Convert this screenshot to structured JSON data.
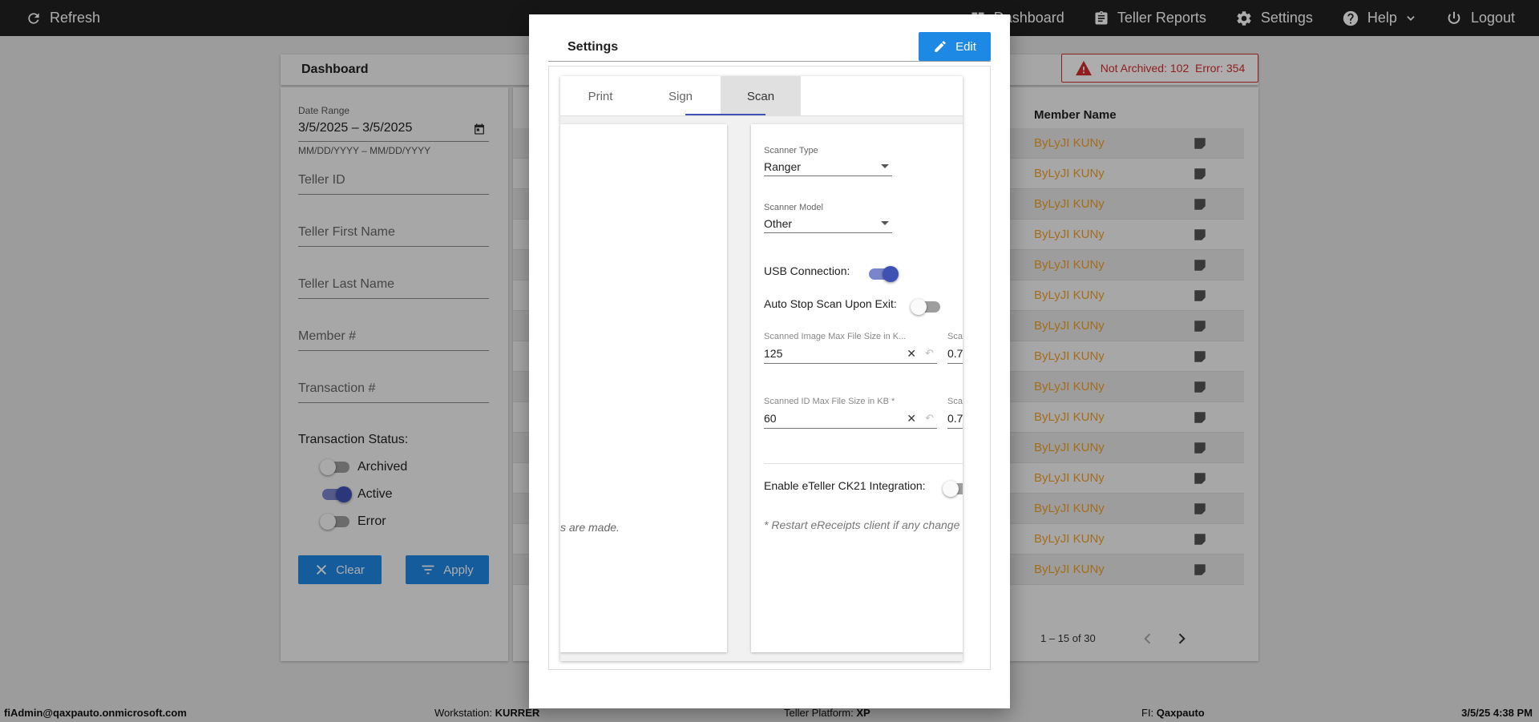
{
  "topbar": {
    "refresh_label": "Refresh",
    "nav": {
      "dashboard": "Dashboard",
      "teller_reports": "Teller Reports",
      "settings": "Settings",
      "help": "Help",
      "logout": "Logout"
    }
  },
  "dashboard": {
    "title": "Dashboard",
    "status_badge": "Not Archived: 102  Error: 354"
  },
  "filters": {
    "date_range_label": "Date Range",
    "date_range_value": "3/5/2025 – 3/5/2025",
    "date_format_hint": "MM/DD/YYYY – MM/DD/YYYY",
    "teller_id": "Teller ID",
    "teller_first_name": "Teller First Name",
    "teller_last_name": "Teller Last Name",
    "member_number": "Member #",
    "transaction_number": "Transaction #",
    "transaction_status_label": "Transaction Status:",
    "statuses": [
      {
        "label": "Archived",
        "on": false
      },
      {
        "label": "Active",
        "on": true
      },
      {
        "label": "Error",
        "on": false
      }
    ],
    "clear_label": "Clear",
    "apply_label": "Apply"
  },
  "table": {
    "member_name_header": "Member Name",
    "rows": [
      "ByLyJI KUNy",
      "ByLyJI KUNy",
      "ByLyJI KUNy",
      "ByLyJI KUNy",
      "ByLyJI KUNy",
      "ByLyJI KUNy",
      "ByLyJI KUNy",
      "ByLyJI KUNy",
      "ByLyJI KUNy",
      "ByLyJI KUNy",
      "ByLyJI KUNy",
      "ByLyJI KUNy",
      "ByLyJI KUNy",
      "ByLyJI KUNy",
      "ByLyJI KUNy"
    ],
    "pagination": "1 – 15 of 30"
  },
  "settings_modal": {
    "title": "Settings",
    "edit_label": "Edit",
    "tabs": [
      "Print",
      "Sign",
      "Scan"
    ],
    "active_tab": "Scan",
    "left_card_note": "s are made.",
    "scanner_type_label": "Scanner Type",
    "scanner_type_value": "Ranger",
    "scanner_model_label": "Scanner Model",
    "scanner_model_value": "Other",
    "usb_connection_label": "USB Connection:",
    "usb_connection_on": true,
    "auto_stop_label": "Auto Stop Scan Upon Exit:",
    "auto_stop_on": false,
    "image_max_label": "Scanned Image Max File Size in K...",
    "image_max_value": "125",
    "id_max_label": "Scanned ID Max File Size in KB *",
    "id_max_value": "60",
    "clipped_label": "Sca",
    "clipped_value_1": "0.7",
    "clipped_value_2": "0.7",
    "ck21_label": "Enable eTeller CK21 Integration:",
    "ck21_on": false,
    "restart_note": "* Restart eReceipts client if any change"
  },
  "statusbar": {
    "user": "fiAdmin@qaxpauto.onmicrosoft.com",
    "workstation_label": "Workstation:",
    "workstation_value": "KURRER",
    "platform_label": "Teller Platform:",
    "platform_value": "XP",
    "fi_label": "FI:",
    "fi_value": "Qaxpauto",
    "datetime": "3/5/25 4:38 PM"
  },
  "colors": {
    "topbar": "#212121",
    "accent_blue": "#1e88e5",
    "toggle_indigo": "#3f51b5",
    "member_name_orange": "#f0a12a",
    "error_red": "#d32f2f"
  }
}
